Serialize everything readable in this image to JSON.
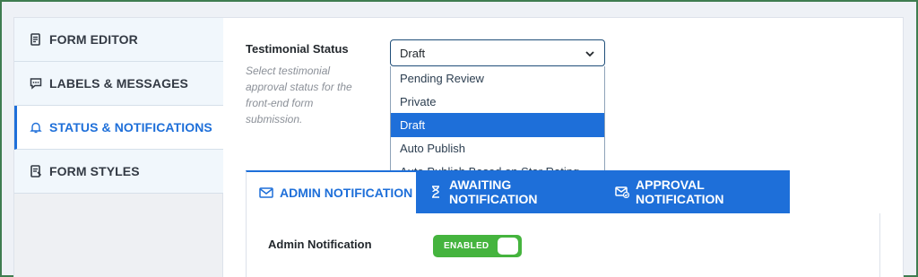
{
  "sidebar": {
    "items": [
      {
        "label": "FORM EDITOR",
        "icon": "form-editor-icon"
      },
      {
        "label": "LABELS & MESSAGES",
        "icon": "chat-bubble-icon"
      },
      {
        "label": "STATUS & NOTIFICATIONS",
        "icon": "bell-icon",
        "active": true
      },
      {
        "label": "FORM STYLES",
        "icon": "form-styles-icon"
      }
    ]
  },
  "status": {
    "label": "Testimonial Status",
    "help": "Select testimonial approval status for the front-end form submission.",
    "selected": "Draft",
    "options": [
      "Pending Review",
      "Private",
      "Draft",
      "Auto Publish",
      "Auto Publish Based on Star Rating"
    ]
  },
  "tabs": [
    {
      "label": "ADMIN NOTIFICATION",
      "icon": "envelope-icon",
      "active": true
    },
    {
      "label": "AWAITING NOTIFICATION",
      "icon": "hourglass-icon",
      "active": false
    },
    {
      "label": "APPROVAL NOTIFICATION",
      "icon": "envelope-check-icon",
      "active": false
    }
  ],
  "admin_notification": {
    "label": "Admin Notification",
    "toggle_text": "ENABLED",
    "enabled": true
  },
  "colors": {
    "accent": "#1e6fd9",
    "toggle_on": "#45b43e",
    "frame": "#3f7d50"
  }
}
